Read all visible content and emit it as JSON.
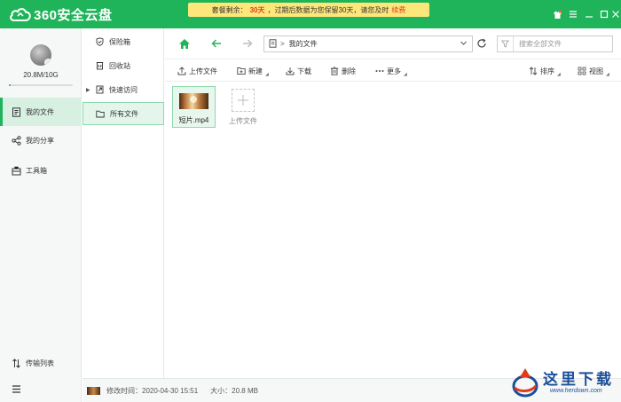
{
  "app": {
    "title": "360安全云盘",
    "notice": {
      "prefix": "套餐剩余：",
      "days": "30天",
      "message": "，过期后数据为您保留30天，请您及时",
      "link": "续费"
    }
  },
  "window_controls": [
    "skin-icon",
    "menu-icon",
    "minimize-icon",
    "maximize-icon",
    "close-icon"
  ],
  "account": {
    "quota": "20.8M/10G",
    "usage_fraction": 0.002
  },
  "sidebar": {
    "items": [
      {
        "label": "我的文件",
        "icon": "file-icon",
        "active": true
      },
      {
        "label": "我的分享",
        "icon": "share-icon",
        "active": false
      },
      {
        "label": "工具箱",
        "icon": "toolbox-icon",
        "active": false
      }
    ],
    "transfer_label": "传输列表"
  },
  "tree": {
    "items": [
      {
        "label": "保险箱",
        "icon": "shield-icon"
      },
      {
        "label": "回收站",
        "icon": "recycle-bin-icon"
      },
      {
        "label": "快速访问",
        "icon": "quick-access-icon"
      },
      {
        "label": "所有文件",
        "icon": "folder-icon"
      }
    ]
  },
  "navbar": {
    "path_root": "我的文件",
    "search_placeholder": "搜索全部文件"
  },
  "toolbar": {
    "upload": "上传文件",
    "new": "新建",
    "download": "下载",
    "delete": "删除",
    "more": "更多",
    "sort": "排序",
    "view": "视图"
  },
  "files": [
    {
      "name": "短片.mp4",
      "type": "video"
    }
  ],
  "upload_tile_label": "上传文件",
  "status": {
    "modified": "修改时间：2020-04-30 15:51",
    "size": "大小：20.8 MB"
  },
  "watermark": {
    "text": "这里下载",
    "url": "www.herdown.com"
  },
  "colors": {
    "brand_green": "#1fb35a",
    "notice_bg": "#fde77a",
    "highlight_red": "#e03b1d"
  }
}
